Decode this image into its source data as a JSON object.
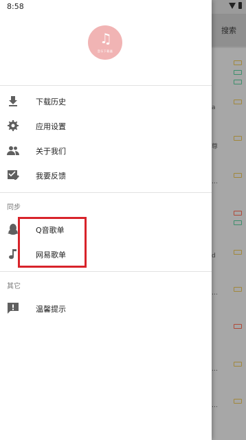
{
  "status_bar": {
    "time": "8:58"
  },
  "background": {
    "search_label": "搜索"
  },
  "drawer": {
    "logo_text": "音乐下载器",
    "menu_primary": [
      {
        "label": "下载历史",
        "icon": "download-icon"
      },
      {
        "label": "应用设置",
        "icon": "gear-icon"
      },
      {
        "label": "关于我们",
        "icon": "people-icon"
      },
      {
        "label": "我要反馈",
        "icon": "feedback-icon"
      }
    ],
    "sync_section": {
      "title": "同步",
      "items": [
        {
          "label": "Q音歌单",
          "icon": "qq-penguin-icon"
        },
        {
          "label": "网易歌单",
          "icon": "music-note-icon"
        }
      ]
    },
    "other_section": {
      "title": "其它",
      "items": [
        {
          "label": "温馨提示",
          "icon": "alert-icon"
        }
      ]
    }
  },
  "bg_list": {
    "snippets": [
      "a",
      "尊",
      "…",
      "d",
      "…",
      "…",
      "…"
    ]
  },
  "colors": {
    "highlight": "#d8232a",
    "avatar": "#f1b4b4"
  }
}
